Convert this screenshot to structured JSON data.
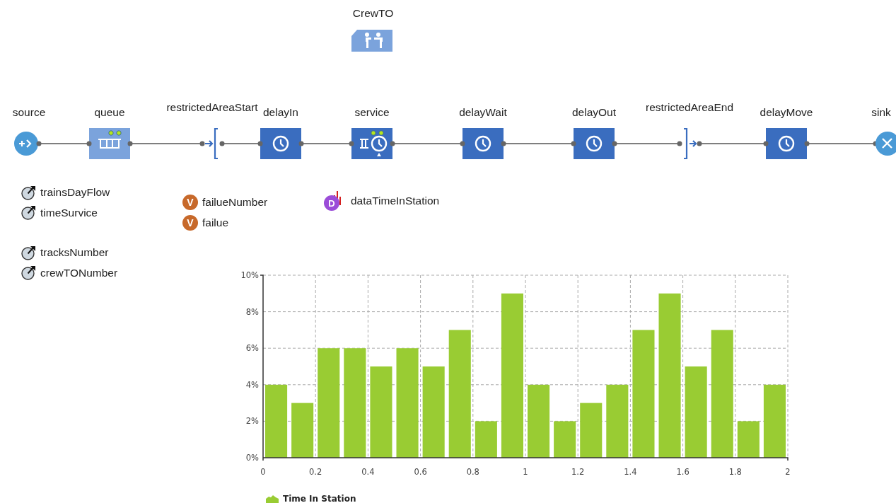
{
  "resource_pool": {
    "name": "CrewTO"
  },
  "flowchart": [
    {
      "name": "source",
      "kind": "source"
    },
    {
      "name": "queue",
      "kind": "queue"
    },
    {
      "name": "restrictedAreaStart",
      "kind": "restricted_start"
    },
    {
      "name": "delayIn",
      "kind": "delay"
    },
    {
      "name": "service",
      "kind": "service"
    },
    {
      "name": "delayWait",
      "kind": "delay"
    },
    {
      "name": "delayOut",
      "kind": "delay"
    },
    {
      "name": "restrictedAreaEnd",
      "kind": "restricted_end"
    },
    {
      "name": "delayMove",
      "kind": "delay"
    },
    {
      "name": "sink",
      "kind": "sink"
    }
  ],
  "parameter_groups": [
    [
      "trainsDayFlow",
      "timeSurvice"
    ],
    [
      "tracksNumber",
      "crewTONumber"
    ]
  ],
  "variables": [
    {
      "name": "failueNumber",
      "badge": "V"
    },
    {
      "name": "failue",
      "badge": "V"
    }
  ],
  "datasets": [
    {
      "name": "dataTimeInStation",
      "badge": "D"
    }
  ],
  "chart": {
    "chart_data": {
      "type": "bar",
      "grid": true,
      "x": [
        0.05,
        0.15,
        0.25,
        0.35,
        0.45,
        0.55,
        0.65,
        0.75,
        0.85,
        0.95,
        1.05,
        1.15,
        1.25,
        1.35,
        1.45,
        1.55,
        1.65,
        1.75,
        1.85,
        1.95
      ],
      "series": [
        {
          "name": "Time In Station",
          "color": "#99cc33",
          "values": [
            4,
            3,
            6,
            6,
            5,
            6,
            5,
            7,
            2,
            9,
            4,
            2,
            3,
            4,
            7,
            9,
            5,
            7,
            2,
            4
          ]
        }
      ],
      "xlim": [
        0,
        2
      ],
      "ylim": [
        0,
        10
      ],
      "xticks": [
        0,
        0.2,
        0.4,
        0.6,
        0.8,
        1,
        1.2,
        1.4,
        1.6,
        1.8,
        2
      ],
      "yticks": [
        {
          "value": 0,
          "label": "0%"
        },
        {
          "value": 2,
          "label": "2%"
        },
        {
          "value": 4,
          "label": "4%"
        },
        {
          "value": 6,
          "label": "6%"
        },
        {
          "value": 8,
          "label": "8%"
        },
        {
          "value": 10,
          "label": "10%"
        }
      ]
    }
  }
}
